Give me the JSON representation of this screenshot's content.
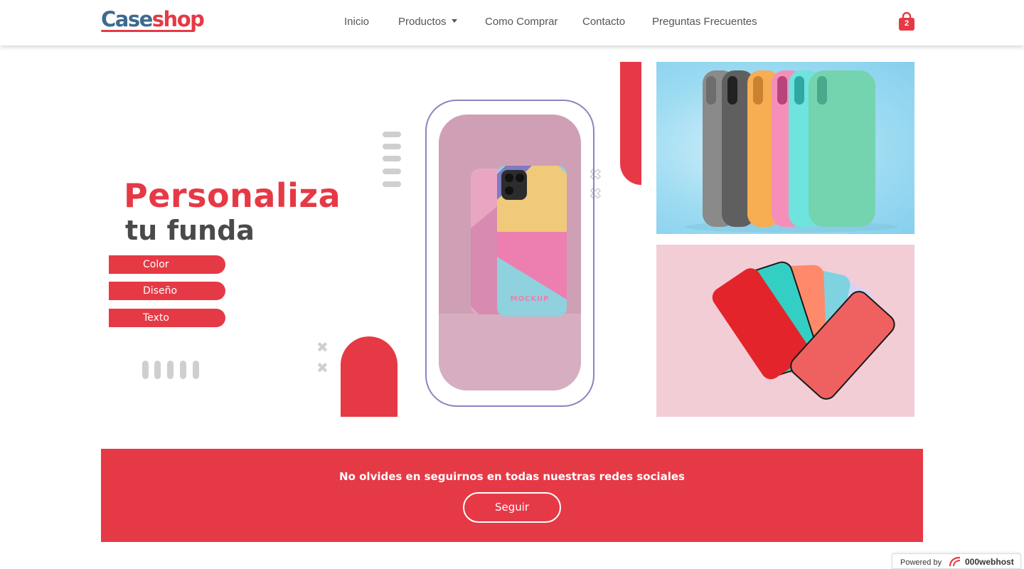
{
  "brand": {
    "logo_part1": "Case",
    "logo_part2": "shop",
    "primary_color": "#e63946",
    "secondary_color": "#3e6a8f"
  },
  "nav": {
    "items": [
      {
        "label": "Inicio"
      },
      {
        "label": "Productos",
        "has_dropdown": true
      },
      {
        "label": "Como Comprar"
      },
      {
        "label": "Contacto"
      },
      {
        "label": "Preguntas Frecuentes"
      }
    ],
    "cart": {
      "icon": "shopping-bag-icon",
      "count": "2"
    }
  },
  "hero": {
    "headline_1": "Personaliza",
    "headline_2": "tu funda",
    "options": [
      "Color",
      "Diseño",
      "Texto"
    ],
    "phone_mockup_text": "MOCKUP",
    "phone_colors": [
      "#7f7ac2",
      "#f0c97a",
      "#ec7fb0",
      "#8fd1dc"
    ]
  },
  "gallery": {
    "top_case_colors": [
      "#8a8a8a",
      "#5f5f5f",
      "#f7ad52",
      "#f58fb9",
      "#6fe3de",
      "#74d4b0"
    ],
    "bottom_case_colors": [
      "#e3252b",
      "#34cfc4",
      "#ff8a6b",
      "#7fd3e0",
      "#d3d3f5",
      "#ef6160"
    ]
  },
  "cta": {
    "message": "No olvides en seguirnos en todas nuestras redes sociales",
    "button_label": "Seguir"
  },
  "badge": {
    "powered_label": "Powered by",
    "brand_label": "000webhost"
  }
}
